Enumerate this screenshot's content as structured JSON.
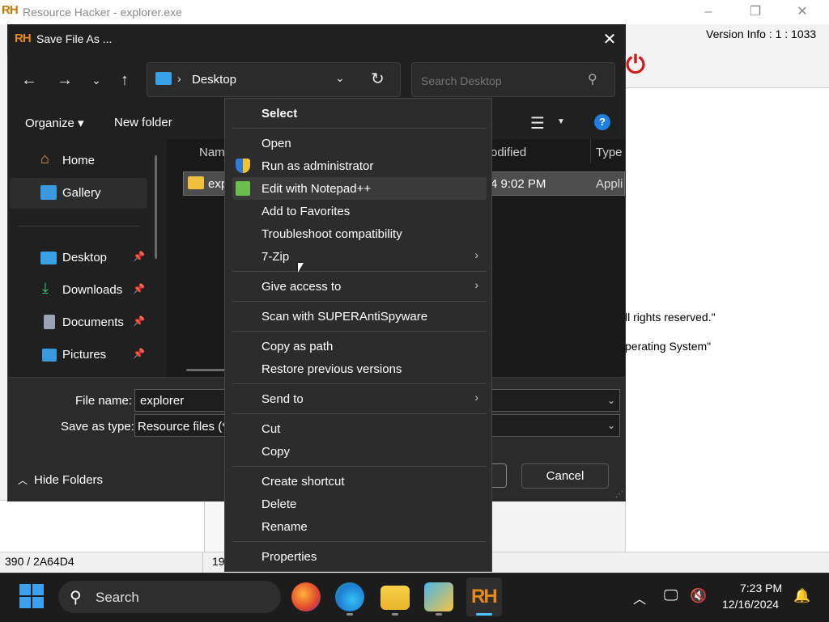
{
  "rh_window": {
    "title": "Resource Hacker - explorer.exe",
    "logo": "RH",
    "version_info": "Version Info : 1 : 1033",
    "text_line_1": "ll rights reserved.\"",
    "text_line_2": "perating System\"",
    "status_left": "390 / 2A64D4",
    "status_mid": "19",
    "minimize_icon": "minimize-icon",
    "restore_icon": "restore-icon",
    "close_icon": "close-icon"
  },
  "dialog": {
    "title": "Save File As ...",
    "logo": "RH",
    "address": {
      "separator": "›",
      "location": "Desktop"
    },
    "search": {
      "placeholder": "Search Desktop"
    },
    "toolbar": {
      "organize": "Organize ▾",
      "new_folder": "New folder"
    },
    "nav_pane": {
      "items": [
        {
          "label": "Home",
          "icon": "home-icon"
        },
        {
          "label": "Gallery",
          "icon": "gallery-icon"
        },
        {
          "label": "Desktop",
          "icon": "desktop-icon",
          "pinned": true
        },
        {
          "label": "Downloads",
          "icon": "downloads-icon",
          "pinned": true
        },
        {
          "label": "Documents",
          "icon": "documents-icon",
          "pinned": true
        },
        {
          "label": "Pictures",
          "icon": "pictures-icon",
          "pinned": true
        }
      ],
      "pin_glyph": "📌"
    },
    "columns": {
      "name": "Nam",
      "modified": "odified",
      "type": "Type"
    },
    "file_row": {
      "name": "exp",
      "modified": "4 9:02 PM",
      "type": "Appli"
    },
    "file_name_label": "File name:",
    "file_name_value": "explorer",
    "save_type_label": "Save as type:",
    "save_type_value": "Resource files (*",
    "hide_folders": "Hide Folders",
    "cancel": "Cancel"
  },
  "context_menu": {
    "items": [
      {
        "label": "Select",
        "bold": true
      },
      {
        "label": "Open"
      },
      {
        "label": "Run as administrator",
        "icon": "shield-icon"
      },
      {
        "label": "Edit with Notepad++",
        "icon": "notepadpp-icon"
      },
      {
        "label": "Add to Favorites"
      },
      {
        "label": "Troubleshoot compatibility"
      },
      {
        "label": "7-Zip",
        "submenu": true
      },
      {
        "label": "Give access to",
        "submenu": true
      },
      {
        "label": "Scan with SUPERAntiSpyware"
      },
      {
        "label": "Copy as path"
      },
      {
        "label": "Restore previous versions"
      },
      {
        "label": "Send to",
        "submenu": true
      },
      {
        "label": "Cut"
      },
      {
        "label": "Copy"
      },
      {
        "label": "Create shortcut"
      },
      {
        "label": "Delete"
      },
      {
        "label": "Rename"
      },
      {
        "label": "Properties"
      }
    ],
    "highlighted": "Edit with Notepad++"
  },
  "taskbar": {
    "search_label": "Search",
    "apps": [
      "firefox-icon",
      "edge-icon",
      "file-explorer-icon",
      "visual-studio-icon",
      "resource-hacker-icon"
    ],
    "rh_label": "RH",
    "clock_time": "7:23 PM",
    "clock_date": "12/16/2024"
  },
  "colors": {
    "dialog_bg": "#202020",
    "menu_bg": "#2c2c2c",
    "accent": "#4cc2ff",
    "rh_orange": "#e88a1a",
    "power_red": "#d01818"
  }
}
